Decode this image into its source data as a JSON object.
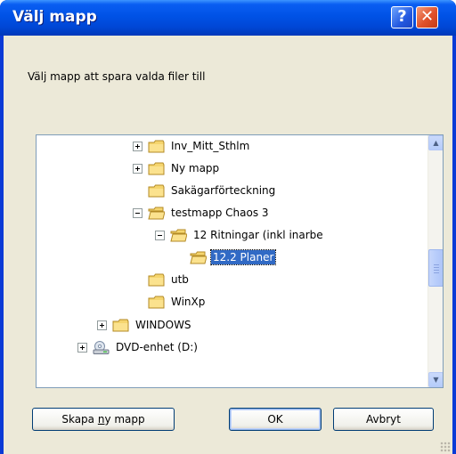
{
  "window": {
    "title": "Välj mapp"
  },
  "titlebar": {
    "help_label": "?",
    "close_label": "✕"
  },
  "prompt": "Välj mapp att spara valda filer till",
  "tree": {
    "items": [
      {
        "label": "Inv_Mitt_Sthlm",
        "expander": "plus",
        "icon": "folder-closed-icon"
      },
      {
        "label": "Ny mapp",
        "expander": "plus",
        "icon": "folder-closed-icon"
      },
      {
        "label": "Sakägarförteckning",
        "expander": "none",
        "icon": "folder-closed-icon"
      },
      {
        "label": "testmapp Chaos 3",
        "expander": "minus",
        "icon": "folder-open-icon"
      },
      {
        "label": "12 Ritningar (inkl inarbe",
        "expander": "minus",
        "icon": "folder-open-icon"
      },
      {
        "label": "12.2 Planer",
        "expander": "none",
        "icon": "folder-open-icon",
        "selected": true
      },
      {
        "label": "utb",
        "expander": "none",
        "icon": "folder-closed-icon"
      },
      {
        "label": "WinXp",
        "expander": "none",
        "icon": "folder-closed-icon"
      },
      {
        "label": "WINDOWS",
        "expander": "plus",
        "icon": "folder-closed-icon"
      },
      {
        "label": "DVD-enhet (D:)",
        "expander": "plus",
        "icon": "dvd-drive-icon"
      }
    ]
  },
  "buttons": {
    "new_folder_pre": "Skapa ",
    "new_folder_mnemonic": "n",
    "new_folder_post": "y mapp",
    "ok": "OK",
    "cancel": "Avbryt"
  },
  "colors": {
    "title_blue": "#0052e6",
    "client_bg": "#ece9d8",
    "selection": "#316ac5",
    "close_red": "#e0512a"
  }
}
